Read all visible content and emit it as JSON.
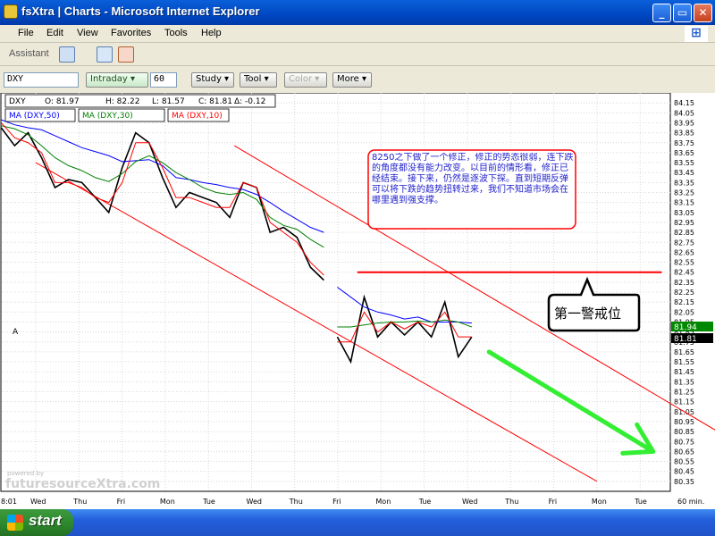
{
  "window": {
    "title": "fsXtra | Charts - Microsoft Internet Explorer"
  },
  "window_controls": {
    "minimize": "_",
    "maximize": "▭",
    "close": "✕"
  },
  "menu": [
    "File",
    "Edit",
    "View",
    "Favorites",
    "Tools",
    "Help"
  ],
  "assistant_label": "Assistant",
  "toolbar": {
    "symbol": "DXY",
    "interval_label": "Intraday",
    "interval_value": "60",
    "study_label": "Study",
    "tool_label": "Tool",
    "color_label": "Color",
    "more_label": "More"
  },
  "legend": {
    "symbol": "DXY",
    "open": "O: 81.97",
    "high": "H: 82.22",
    "low": "L: 81.57",
    "close": "C: 81.81",
    "change": "Δ: -0.12",
    "ma50": "MA (DXY,50)",
    "ma30": "MA (DXY,30)",
    "ma10": "MA (DXY,10)"
  },
  "annotation_text": "8250之下做了一个修正，修正的势态很弱，连下跌的角度都没有能力改变。以目前的情形看，修正已经结束。接下来，仍然是逐波下探。直到短期反弹可以将下跌的趋势扭转过来，我们不知道市场会在哪里遇到强支撑。",
  "callout_text": "第一警戒位",
  "watermark": {
    "small": "powered by",
    "brand": "futuresourceXtra.com"
  },
  "corner_marker": "A",
  "x_axis_note": "60 min.",
  "x_axis_first_tick": "8:01",
  "start_label": "start",
  "colors": {
    "price": "#000000",
    "ma50": "#0000ff",
    "ma30": "#008000",
    "ma10": "#ff0000",
    "channel": "#ff0000",
    "arrow": "#33ee33",
    "current_price_bg": "#008800",
    "last_close_bg": "#000000"
  },
  "chart_data": {
    "type": "line",
    "title": "",
    "xlabel": "",
    "ylabel": "",
    "ylim": [
      80.25,
      84.25
    ],
    "ytick_step": 0.1,
    "x_categories": [
      "Wed",
      "Thu",
      "Fri",
      "Mon",
      "Tue",
      "Wed",
      "Thu",
      "Fri",
      "Mon",
      "Tue",
      "Wed",
      "Thu",
      "Fri",
      "Mon",
      "Tue"
    ],
    "current_price_label": "81.94",
    "last_close_label": "81.81",
    "series": [
      {
        "name": "DXY",
        "values": [
          83.9,
          83.72,
          83.85,
          83.6,
          83.3,
          83.38,
          83.35,
          83.2,
          83.05,
          83.5,
          83.85,
          83.75,
          83.4,
          83.1,
          83.25,
          83.2,
          83.15,
          83.0,
          83.35,
          83.3,
          82.85,
          82.9,
          82.8,
          82.5,
          82.37,
          81.8,
          81.55,
          82.2,
          81.8,
          81.95,
          81.82,
          81.95,
          81.8,
          82.15,
          81.6,
          81.8
        ]
      },
      {
        "name": "MA (DXY,50)",
        "values": [
          83.98,
          83.93,
          83.9,
          83.88,
          83.82,
          83.76,
          83.7,
          83.66,
          83.62,
          83.56,
          83.57,
          83.58,
          83.52,
          83.4,
          83.38,
          83.35,
          83.33,
          83.3,
          83.28,
          83.23,
          83.15,
          83.06,
          82.98,
          82.9,
          82.85,
          82.3,
          82.2,
          82.1,
          82.05,
          82.02,
          81.98,
          82.0,
          81.95,
          81.95,
          81.95,
          81.94
        ]
      },
      {
        "name": "MA (DXY,30)",
        "values": [
          83.92,
          83.89,
          83.83,
          83.72,
          83.6,
          83.52,
          83.47,
          83.4,
          83.36,
          83.44,
          83.56,
          83.62,
          83.55,
          83.45,
          83.38,
          83.3,
          83.25,
          83.23,
          83.25,
          83.18,
          83.0,
          82.92,
          82.88,
          82.78,
          82.7,
          81.9,
          81.9,
          81.92,
          81.94,
          81.95,
          81.95,
          81.96,
          81.95,
          81.97,
          81.95,
          81.9
        ]
      },
      {
        "name": "MA (DXY,10)",
        "values": [
          83.95,
          83.8,
          83.75,
          83.65,
          83.35,
          83.35,
          83.3,
          83.2,
          83.15,
          83.35,
          83.75,
          83.75,
          83.5,
          83.2,
          83.2,
          83.15,
          83.1,
          83.1,
          83.35,
          83.3,
          82.95,
          82.85,
          82.75,
          82.55,
          82.42,
          81.75,
          81.75,
          82.05,
          81.85,
          81.95,
          81.88,
          81.95,
          81.9,
          82.05,
          81.8,
          81.8
        ]
      }
    ],
    "channel_lines": [
      {
        "from": [
          0,
          83.55
        ],
        "to": [
          13,
          80.35
        ]
      },
      {
        "from": [
          4.6,
          83.72
        ],
        "to": [
          15.8,
          80.85
        ]
      }
    ],
    "resistance_level": 82.45,
    "arrow": {
      "from": [
        10.5,
        81.65
      ],
      "to": [
        14.3,
        80.65
      ]
    }
  }
}
